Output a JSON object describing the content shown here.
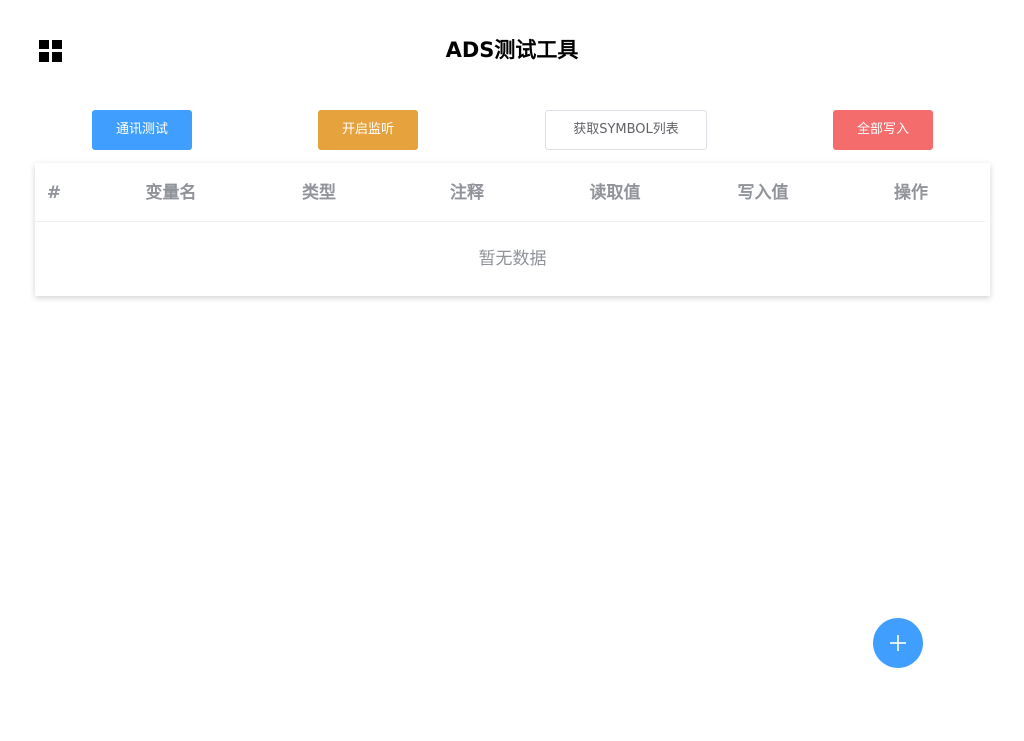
{
  "header": {
    "menu_icon": "grid-menu-icon",
    "title": "ADS测试工具"
  },
  "toolbar": {
    "comm_test_label": "通讯测试",
    "start_monitor_label": "开启监听",
    "get_symbol_list_label": "获取SYMBOL列表",
    "write_all_label": "全部写入"
  },
  "table": {
    "columns": [
      "#",
      "变量名",
      "类型",
      "注释",
      "读取值",
      "写入值",
      "操作"
    ],
    "rows": [],
    "empty_text": "暂无数据"
  },
  "fab": {
    "icon": "plus-icon"
  },
  "colors": {
    "primary": "#409eff",
    "warning": "#e6a23c",
    "danger": "#f56c6c",
    "header_text": "#909399"
  }
}
